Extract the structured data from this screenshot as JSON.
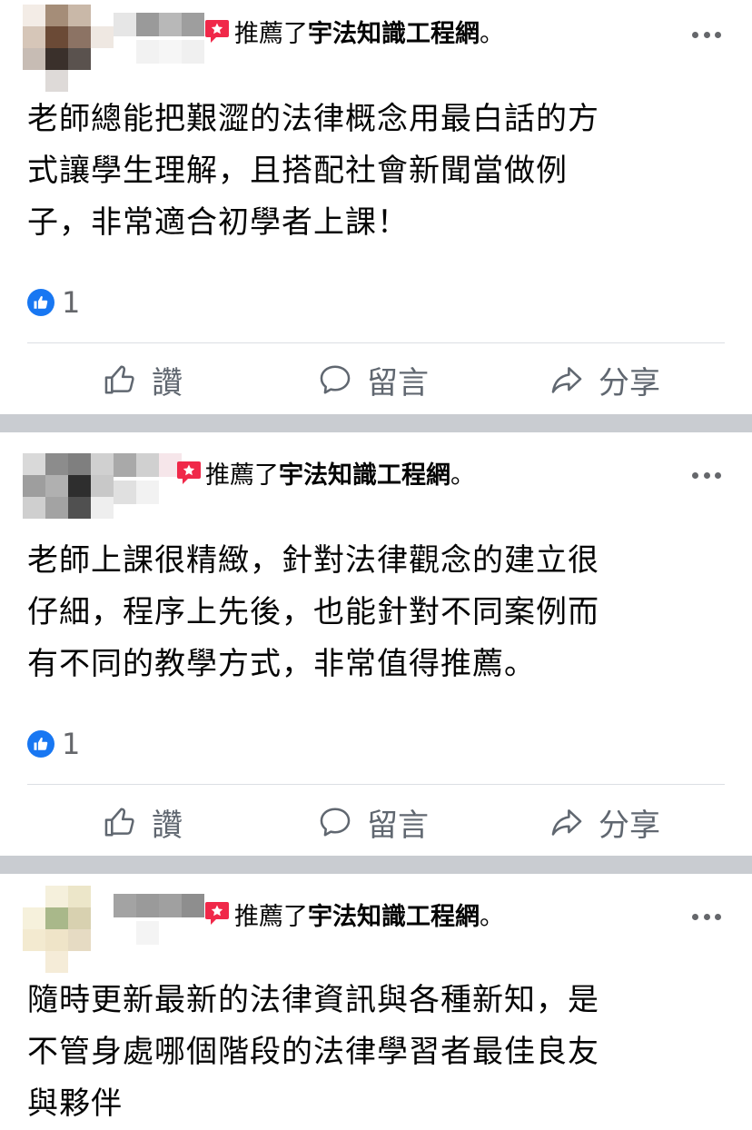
{
  "feed": {
    "posts": [
      {
        "recommend_text": "推薦了",
        "page_name": "宇法知識工程網",
        "period": "。",
        "body_lines": [
          "老師總能把艱澀的法律概念用最白話的方",
          "式讓學生理解，且搭配社會新聞當做例",
          "子，非常適合初學者上課！"
        ],
        "reaction_count": "1"
      },
      {
        "recommend_text": "推薦了",
        "page_name": "宇法知識工程網",
        "period": "。",
        "body_lines": [
          "老師上課很精緻，針對法律觀念的建立很",
          "仔細，程序上先後，也能針對不同案例而",
          "有不同的教學方式，非常值得推薦。"
        ],
        "reaction_count": "1"
      },
      {
        "recommend_text": "推薦了",
        "page_name": "宇法知識工程網",
        "period": "。",
        "body_lines": [
          "隨時更新最新的法律資訊與各種新知，是",
          "不管身處哪個階段的法律學習者最佳良友",
          "與夥伴"
        ]
      }
    ],
    "actions": {
      "like": "讚",
      "comment": "留言",
      "share": "分享"
    }
  },
  "icons": {
    "recommend": "recommend-star-icon",
    "more": "more-options-icon",
    "like_badge": "like-reaction-icon",
    "like": "thumbs-up-icon",
    "comment": "comment-bubble-icon",
    "share": "share-arrow-icon"
  },
  "colors": {
    "recommend_red": "#f02849",
    "like_blue": "#1877f2",
    "muted_text": "#65676b",
    "divider": "#c9ccd1"
  }
}
